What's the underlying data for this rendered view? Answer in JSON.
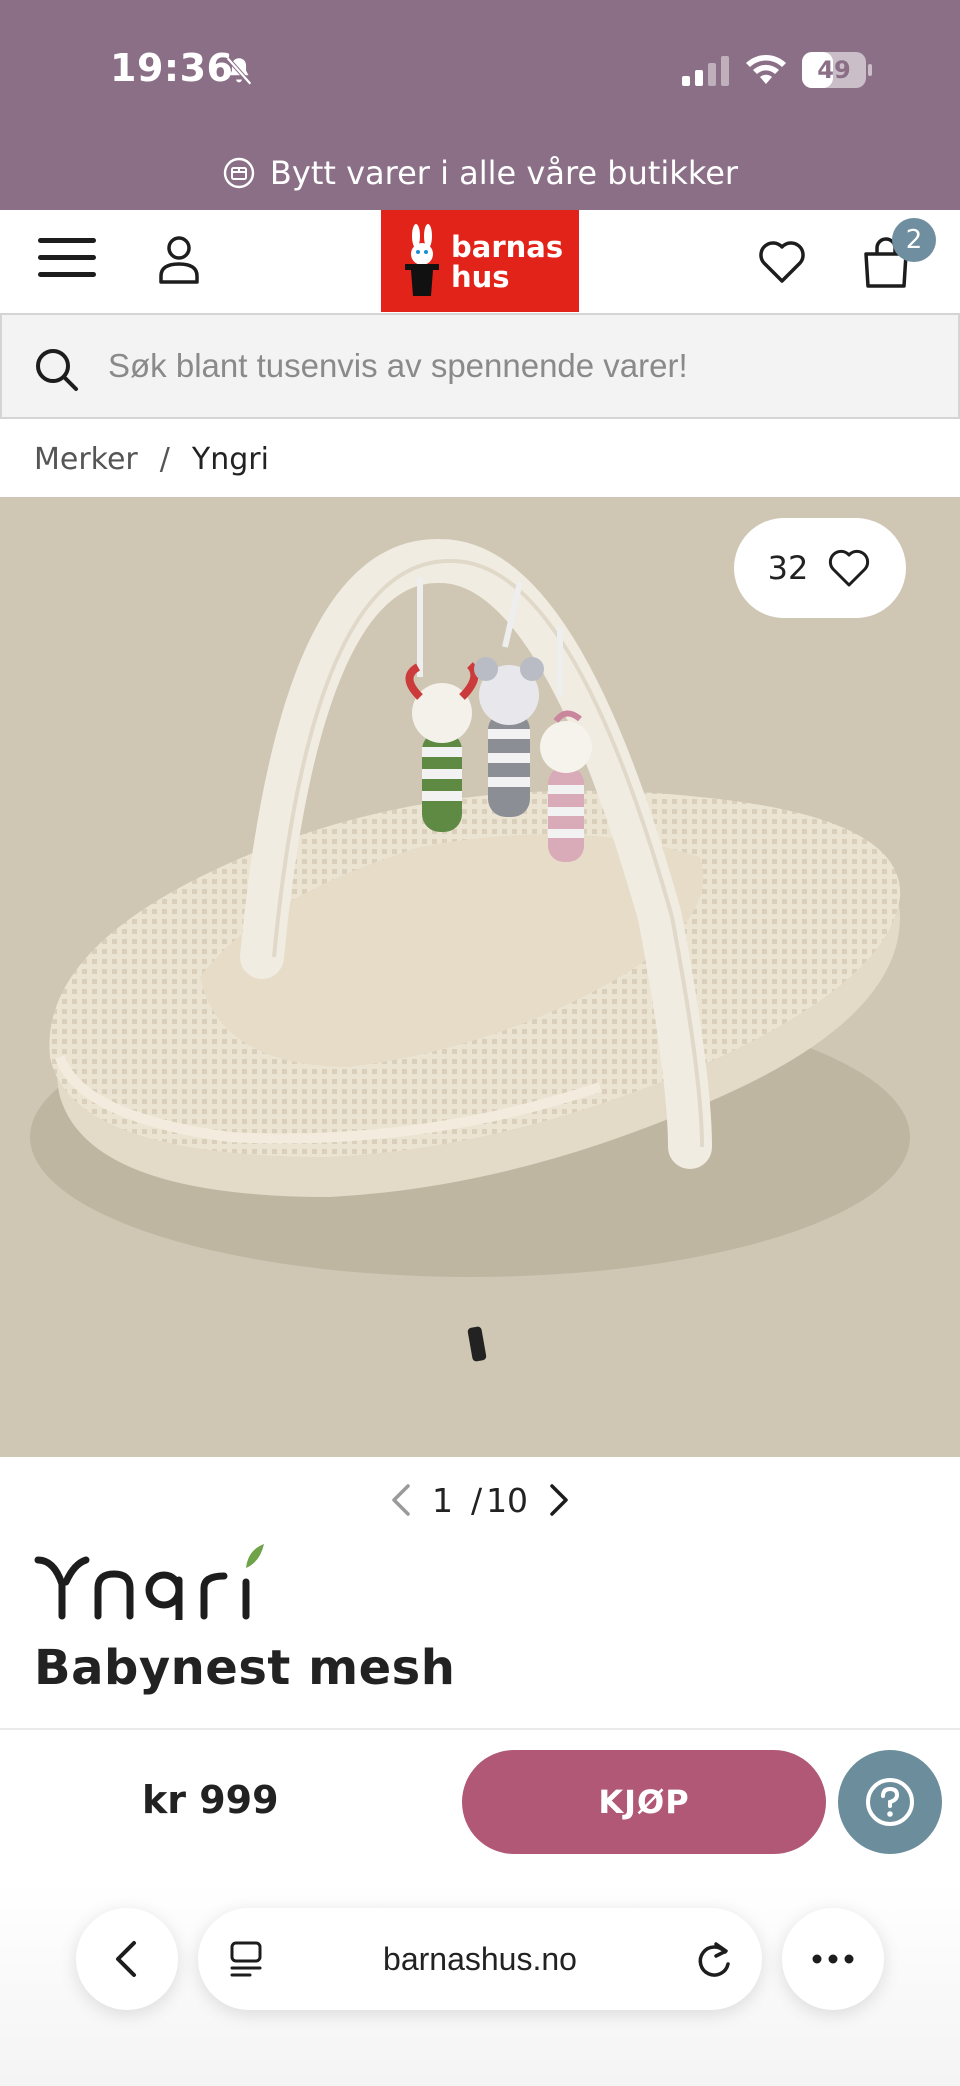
{
  "status_bar": {
    "time": "19:36",
    "battery": "49",
    "battery_level": 0.49
  },
  "promo": {
    "text": "Bytt varer i alle våre butikker"
  },
  "header": {
    "logo_line1": "barnas",
    "logo_line2": "hus",
    "cart_count": "2"
  },
  "search": {
    "placeholder": "Søk blant tusenvis av spennende varer!"
  },
  "breadcrumb": {
    "parent": "Merker",
    "separator": "/",
    "current": "Yngri"
  },
  "product": {
    "favorite_count": "32",
    "pager": {
      "current": "1",
      "separator": "/",
      "total": "10"
    },
    "brand": "Yngri",
    "title": "Babynest mesh",
    "price": "kr 999",
    "buy_label": "KJØP"
  },
  "browser": {
    "domain": "barnashus.no"
  },
  "colors": {
    "promo_band": "#8a6f86",
    "logo_red": "#e2231a",
    "buy_button": "#b05876",
    "help_button": "#6c8d9b",
    "cart_badge": "#6f8fa0",
    "image_background": "#cfc7b4"
  },
  "icons": [
    "bell-off-icon",
    "signal-icon",
    "wifi-icon",
    "battery-icon",
    "exchange-icon",
    "menu-icon",
    "user-icon",
    "heart-icon",
    "cart-icon",
    "search-icon",
    "chevron-left-icon",
    "chevron-right-icon",
    "question-icon",
    "back-icon",
    "reader-icon",
    "reload-icon",
    "more-icon"
  ]
}
